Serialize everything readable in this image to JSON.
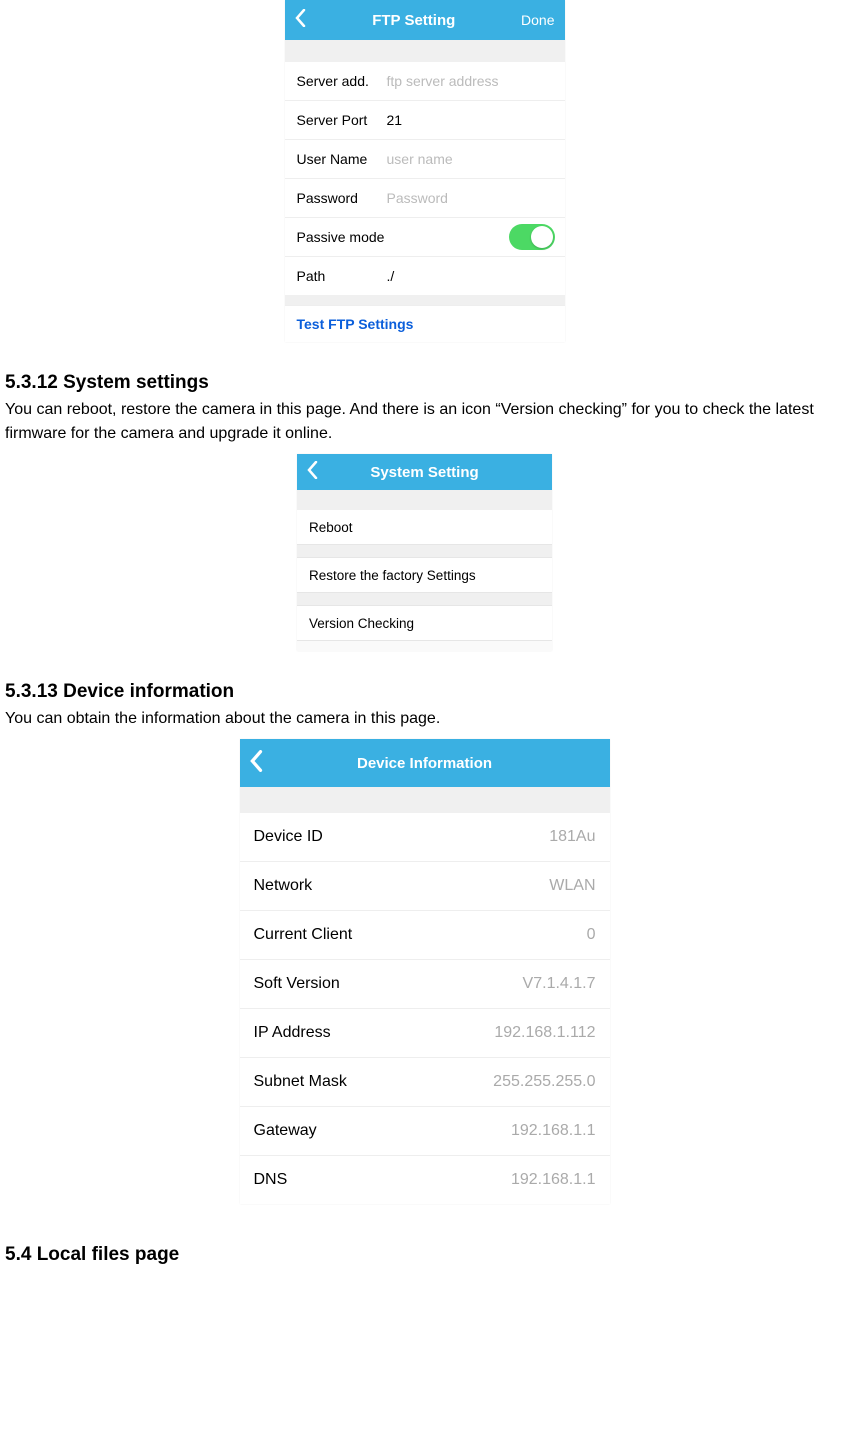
{
  "ftp": {
    "title": "FTP Setting",
    "done": "Done",
    "server_add_label": "Server add.",
    "server_add_placeholder": "ftp server address",
    "server_port_label": "Server Port",
    "server_port_value": "21",
    "user_name_label": "User Name",
    "user_name_placeholder": "user name",
    "password_label": "Password",
    "password_placeholder": "Password",
    "passive_mode_label": "Passive mode",
    "path_label": "Path",
    "path_value": "./",
    "test_link": "Test FTP Settings"
  },
  "sec_system": {
    "heading": "5.3.12 System settings",
    "body": "You can reboot, restore the camera in this page. And there is an icon “Version checking” for you to check the latest firmware for the camera and upgrade it online."
  },
  "system": {
    "title": "System Setting",
    "reboot": "Reboot",
    "restore": "Restore the factory Settings",
    "version": "Version Checking"
  },
  "sec_device": {
    "heading": "5.3.13 Device information",
    "body": "You can obtain the information about the camera in this page."
  },
  "device": {
    "title": "Device Information",
    "rows": {
      "device_id_label": "Device ID",
      "device_id_value": "181Au",
      "network_label": "Network",
      "network_value": "WLAN",
      "current_client_label": "Current Client",
      "current_client_value": "0",
      "soft_version_label": "Soft Version",
      "soft_version_value": "V7.1.4.1.7",
      "ip_address_label": "IP Address",
      "ip_address_value": "192.168.1.112",
      "subnet_mask_label": "Subnet Mask",
      "subnet_mask_value": "255.255.255.0",
      "gateway_label": "Gateway",
      "gateway_value": "192.168.1.1",
      "dns_label": "DNS",
      "dns_value": "192.168.1.1"
    }
  },
  "sec_local": {
    "heading": "5.4 Local files page"
  }
}
